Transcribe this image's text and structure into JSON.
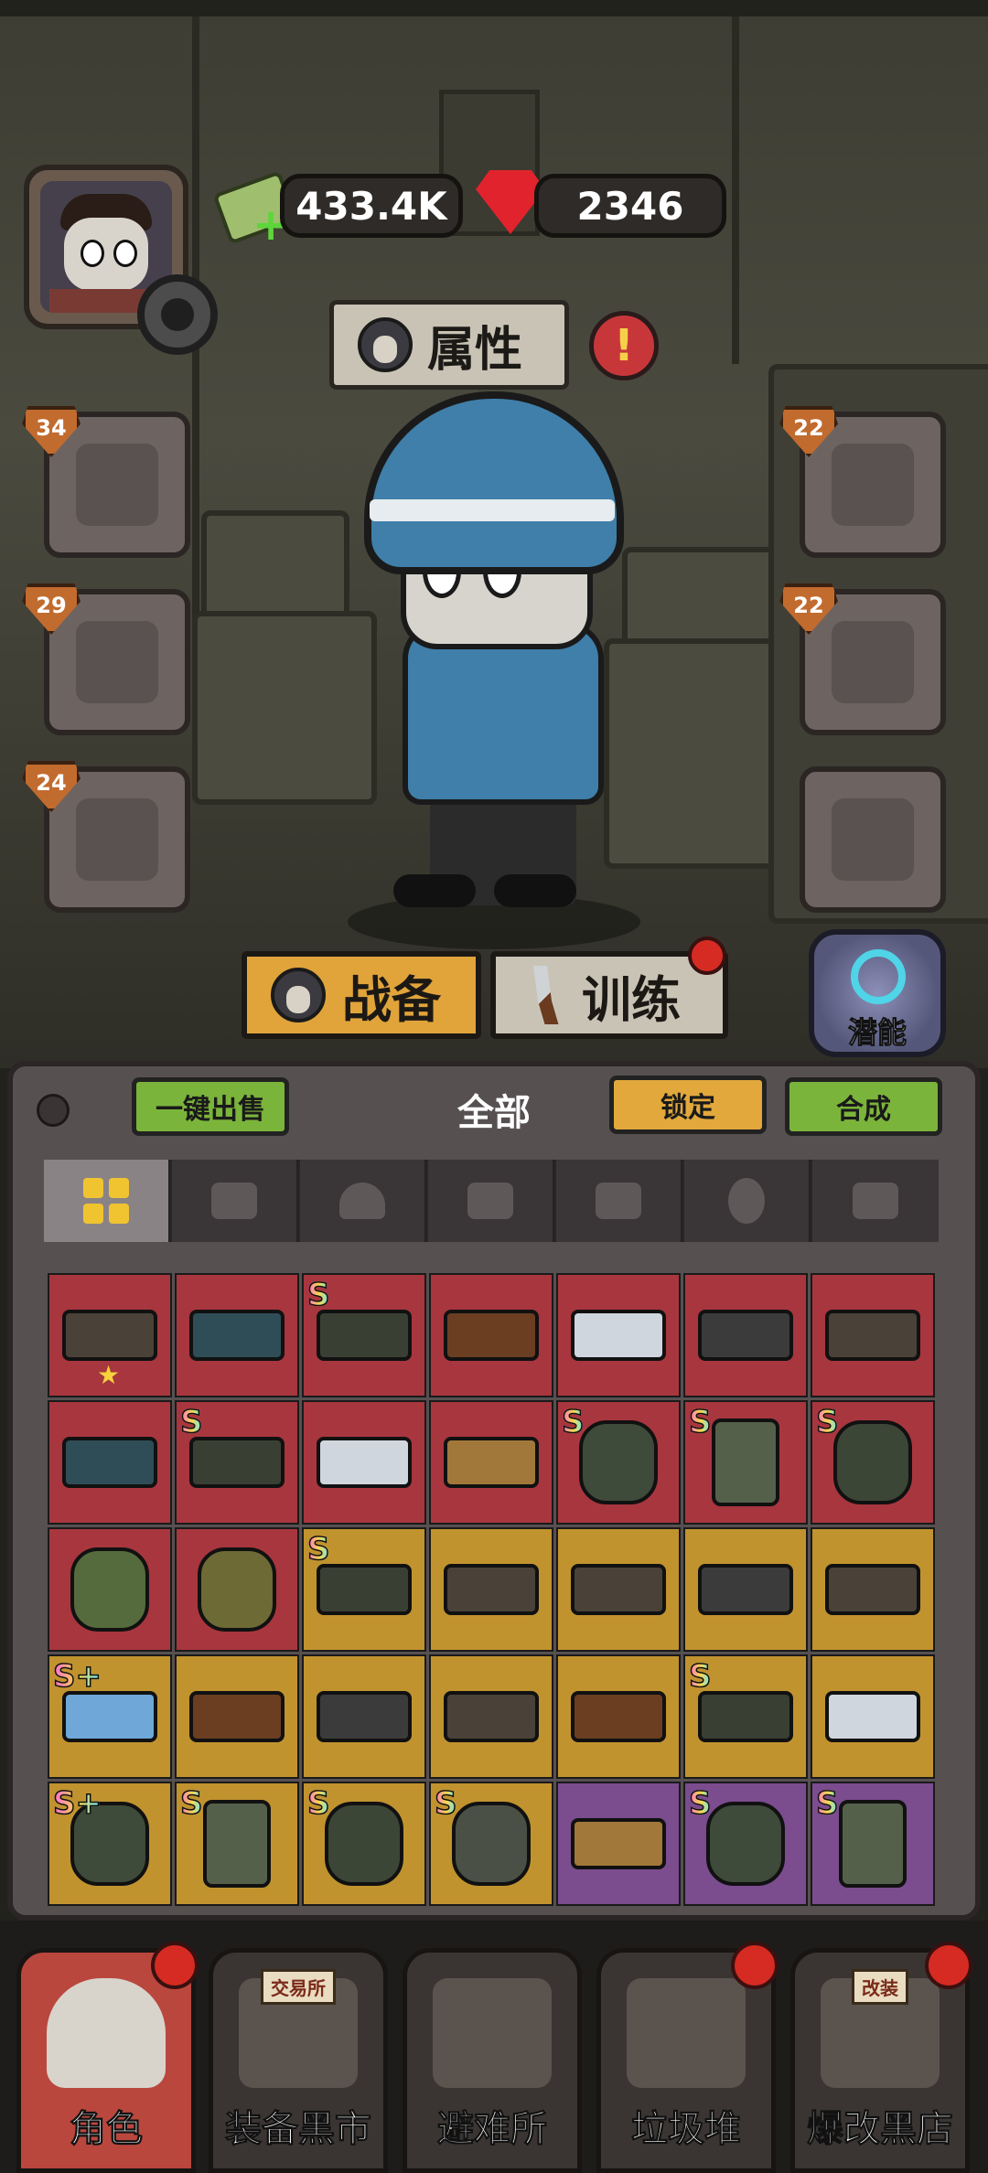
{
  "currency": {
    "cash": "433.4K",
    "gems": "2346"
  },
  "attributes": {
    "label": "属性",
    "alert_mark": "!"
  },
  "equip_slots_left": [
    {
      "level": "34",
      "type": "weapon"
    },
    {
      "level": "29",
      "type": "helmet"
    },
    {
      "level": "24",
      "type": "pants"
    }
  ],
  "equip_slots_right": [
    {
      "level": "22",
      "type": "armor"
    },
    {
      "level": "22",
      "type": "mask"
    },
    {
      "level": "",
      "type": "backpack"
    }
  ],
  "mode_tabs": {
    "gear": "战备",
    "training": "训练",
    "potential": "潜能"
  },
  "inventory": {
    "sell_all": "一键出售",
    "title": "全部",
    "lock": "锁定",
    "merge": "合成",
    "filters": [
      "all-grid-icon",
      "weapon-icon",
      "helmet-icon",
      "pants-icon",
      "armor-icon",
      "mask-icon",
      "backpack-icon"
    ],
    "items": [
      {
        "color": "red",
        "rank": "",
        "kind": "rifle",
        "star": true
      },
      {
        "color": "red",
        "rank": "",
        "kind": "launcher"
      },
      {
        "color": "red",
        "rank": "S",
        "kind": "minigun"
      },
      {
        "color": "red",
        "rank": "",
        "kind": "ak"
      },
      {
        "color": "red",
        "rank": "",
        "kind": "cannon"
      },
      {
        "color": "red",
        "rank": "",
        "kind": "smg"
      },
      {
        "color": "red",
        "rank": "",
        "kind": "rifle"
      },
      {
        "color": "red",
        "rank": "",
        "kind": "launcher"
      },
      {
        "color": "red",
        "rank": "S",
        "kind": "minigun"
      },
      {
        "color": "red",
        "rank": "",
        "kind": "cannon"
      },
      {
        "color": "red",
        "rank": "",
        "kind": "sniper"
      },
      {
        "color": "red",
        "rank": "S",
        "kind": "helmet"
      },
      {
        "color": "red",
        "rank": "S",
        "kind": "boots"
      },
      {
        "color": "red",
        "rank": "S",
        "kind": "armor"
      },
      {
        "color": "red",
        "rank": "",
        "kind": "battery"
      },
      {
        "color": "red",
        "rank": "",
        "kind": "backpack"
      },
      {
        "color": "gold",
        "rank": "S",
        "kind": "minigun"
      },
      {
        "color": "gold",
        "rank": "",
        "kind": "rifle"
      },
      {
        "color": "gold",
        "rank": "",
        "kind": "rifle"
      },
      {
        "color": "gold",
        "rank": "",
        "kind": "smg"
      },
      {
        "color": "gold",
        "rank": "",
        "kind": "rifle"
      },
      {
        "color": "gold",
        "rank": "S+",
        "kind": "blaster"
      },
      {
        "color": "gold",
        "rank": "",
        "kind": "ak"
      },
      {
        "color": "gold",
        "rank": "",
        "kind": "smg"
      },
      {
        "color": "gold",
        "rank": "",
        "kind": "rifle"
      },
      {
        "color": "gold",
        "rank": "",
        "kind": "ak"
      },
      {
        "color": "gold",
        "rank": "S",
        "kind": "minigun"
      },
      {
        "color": "gold",
        "rank": "",
        "kind": "cannon"
      },
      {
        "color": "gold",
        "rank": "S+",
        "kind": "helmet"
      },
      {
        "color": "gold",
        "rank": "S",
        "kind": "boots"
      },
      {
        "color": "gold",
        "rank": "S",
        "kind": "armor"
      },
      {
        "color": "gold",
        "rank": "S",
        "kind": "mask"
      },
      {
        "color": "purple",
        "rank": "",
        "kind": "sniper"
      },
      {
        "color": "purple",
        "rank": "S",
        "kind": "helmet"
      },
      {
        "color": "purple",
        "rank": "S",
        "kind": "boots"
      }
    ]
  },
  "bottom_nav": [
    {
      "label": "角色",
      "active": true,
      "badge": true
    },
    {
      "label": "装备黑市",
      "active": false,
      "badge": false,
      "sign": "交易所"
    },
    {
      "label": "避难所",
      "active": false,
      "badge": false
    },
    {
      "label": "垃圾堆",
      "active": false,
      "badge": true
    },
    {
      "label": "爆改黑店",
      "active": false,
      "badge": true,
      "sign": "改装"
    }
  ]
}
